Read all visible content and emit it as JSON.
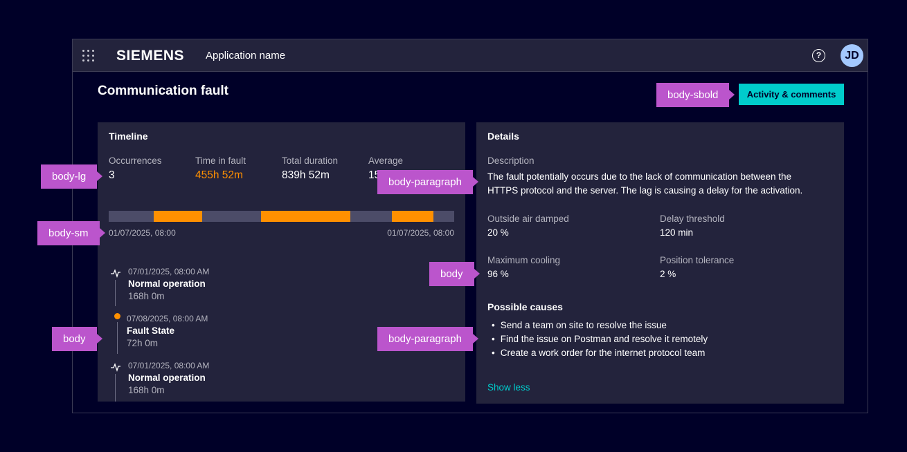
{
  "appbar": {
    "brand": "SIEMENS",
    "app_name": "Application name",
    "help_glyph": "?",
    "avatar_initials": "JD"
  },
  "page": {
    "title": "Communication fault",
    "activity_button": "Activity & comments"
  },
  "timeline": {
    "title": "Timeline",
    "kpis": [
      {
        "label": "Occurrences",
        "value": "3"
      },
      {
        "label": "Time in fault",
        "value": "455h 52m"
      },
      {
        "label": "Total duration",
        "value": "839h 52m"
      },
      {
        "label": "Average",
        "value": "15"
      }
    ],
    "bar": {
      "fault_segments": [
        [
          0.13,
          0.27
        ],
        [
          0.44,
          0.7
        ],
        [
          0.82,
          0.94
        ]
      ],
      "start_label": "01/07/2025, 08:00",
      "end_label": "01/07/2025, 08:00"
    },
    "events": [
      {
        "time": "07/01/2025, 08:00 AM",
        "title": "Normal operation",
        "duration": "168h 0m",
        "icon": "activity-icon"
      },
      {
        "time": "07/08/2025, 08:00 AM",
        "title": "Fault State",
        "duration": "72h 0m",
        "icon": "fault-dot-icon"
      },
      {
        "time": "07/01/2025, 08:00 AM",
        "title": "Normal operation",
        "duration": "168h 0m",
        "icon": "activity-icon"
      }
    ]
  },
  "details": {
    "title": "Details",
    "description_label": "Description",
    "description": "The fault potentially occurs due to the lack of communication between the HTTPS protocol and the server. The lag is causing a delay for the activation.",
    "fields": [
      {
        "label": "Outside air damped",
        "value": "20 %"
      },
      {
        "label": "Delay threshold",
        "value": "120 min"
      },
      {
        "label": "Maximum cooling",
        "value": "96 %"
      },
      {
        "label": "Position tolerance",
        "value": "2 %"
      }
    ],
    "causes_title": "Possible causes",
    "causes": [
      "Send a team on site to resolve the issue",
      "Find the issue on Postman and resolve it remotely",
      "Create a work order for the internet protocol team"
    ],
    "show_less": "Show less"
  },
  "annotations": {
    "body_sbold": "body-sbold",
    "body_lg": "body-lg",
    "body_sm": "body-sm",
    "body_left": "body",
    "body_right": "body",
    "body_paragraph_1": "body-paragraph",
    "body_paragraph_2": "body-paragraph"
  },
  "colors": {
    "background": "#000028",
    "panel": "#23233c",
    "accent": "#00cccc",
    "fault": "#ff9000",
    "annotation": "#bb55cc"
  }
}
